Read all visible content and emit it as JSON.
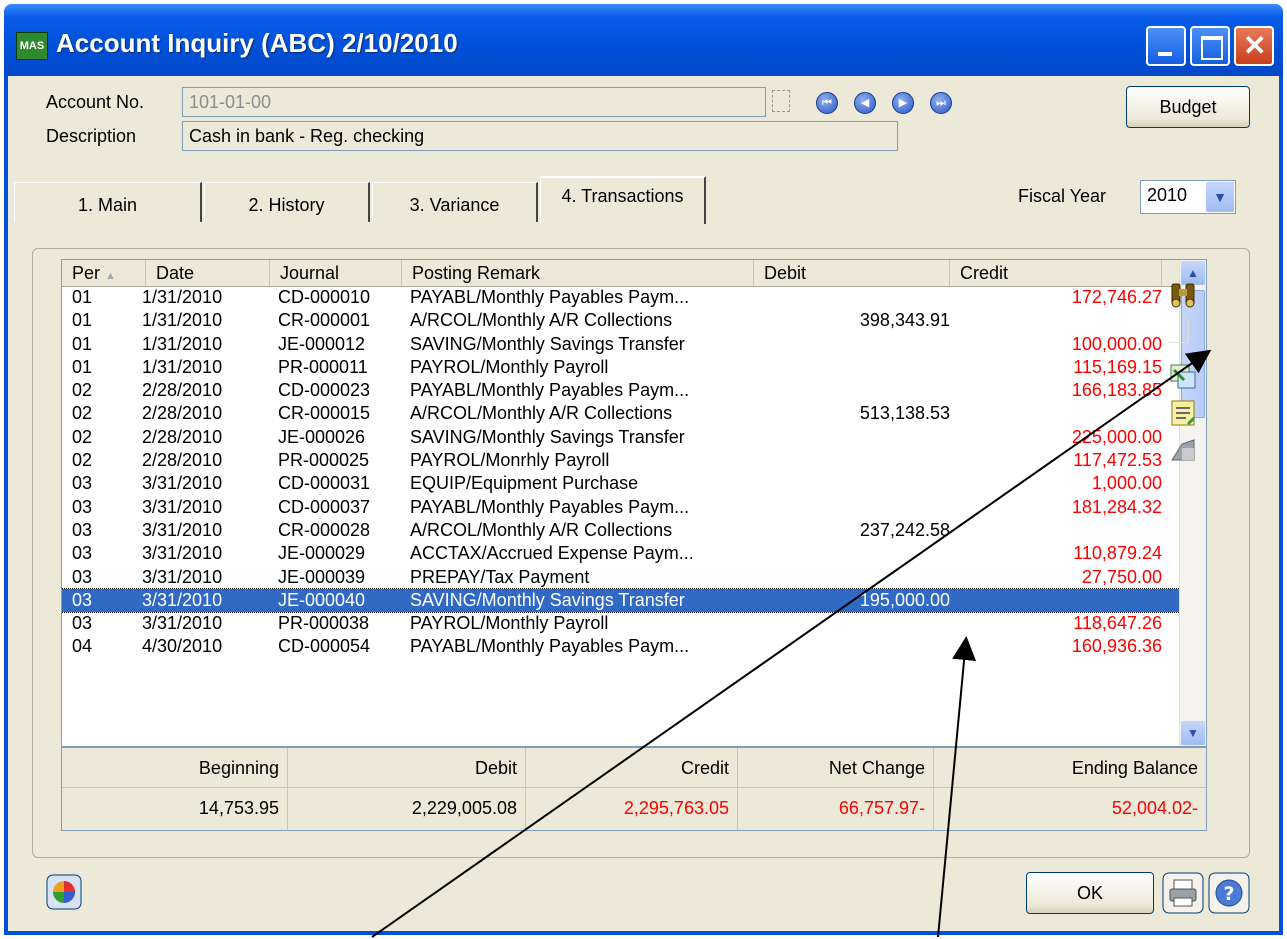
{
  "window": {
    "title": "Account Inquiry (ABC) 2/10/2010",
    "app_icon": "MAS"
  },
  "form": {
    "account_label": "Account No.",
    "account_value": "101-01-00",
    "description_label": "Description",
    "description_value": "Cash in bank - Reg. checking",
    "budget_button": "Budget",
    "fiscal_year_label": "Fiscal Year",
    "fiscal_year_value": "2010"
  },
  "tabs": [
    {
      "label": "1. Main"
    },
    {
      "label": "2. History"
    },
    {
      "label": "3. Variance"
    },
    {
      "label": "4. Transactions"
    }
  ],
  "grid": {
    "columns": [
      "Per",
      "Date",
      "Journal",
      "Posting Remark",
      "Debit",
      "Credit"
    ],
    "rows": [
      {
        "per": "01",
        "date": "1/31/2010",
        "journal": "CD-000010",
        "remark": "PAYABL/Monthly Payables Paym...",
        "debit": "",
        "credit": "172,746.27"
      },
      {
        "per": "01",
        "date": "1/31/2010",
        "journal": "CR-000001",
        "remark": "A/RCOL/Monthly A/R Collections",
        "debit": "398,343.91",
        "credit": ""
      },
      {
        "per": "01",
        "date": "1/31/2010",
        "journal": "JE-000012",
        "remark": "SAVING/Monthly Savings Transfer",
        "debit": "",
        "credit": "100,000.00"
      },
      {
        "per": "01",
        "date": "1/31/2010",
        "journal": "PR-000011",
        "remark": "PAYROL/Monthly Payroll",
        "debit": "",
        "credit": "115,169.15"
      },
      {
        "per": "02",
        "date": "2/28/2010",
        "journal": "CD-000023",
        "remark": "PAYABL/Monthly Payables Paym...",
        "debit": "",
        "credit": "166,183.85"
      },
      {
        "per": "02",
        "date": "2/28/2010",
        "journal": "CR-000015",
        "remark": "A/RCOL/Monthly A/R Collections",
        "debit": "513,138.53",
        "credit": ""
      },
      {
        "per": "02",
        "date": "2/28/2010",
        "journal": "JE-000026",
        "remark": "SAVING/Monthly Savings Transfer",
        "debit": "",
        "credit": "225,000.00"
      },
      {
        "per": "02",
        "date": "2/28/2010",
        "journal": "PR-000025",
        "remark": "PAYROL/Monrhly Payroll",
        "debit": "",
        "credit": "117,472.53"
      },
      {
        "per": "03",
        "date": "3/31/2010",
        "journal": "CD-000031",
        "remark": "EQUIP/Equipment Purchase",
        "debit": "",
        "credit": "1,000.00"
      },
      {
        "per": "03",
        "date": "3/31/2010",
        "journal": "CD-000037",
        "remark": "PAYABL/Monthly Payables Paym...",
        "debit": "",
        "credit": "181,284.32"
      },
      {
        "per": "03",
        "date": "3/31/2010",
        "journal": "CR-000028",
        "remark": "A/RCOL/Monthly A/R Collections",
        "debit": "237,242.58",
        "credit": ""
      },
      {
        "per": "03",
        "date": "3/31/2010",
        "journal": "JE-000029",
        "remark": "ACCTAX/Accrued Expense Paym...",
        "debit": "",
        "credit": "110,879.24"
      },
      {
        "per": "03",
        "date": "3/31/2010",
        "journal": "JE-000039",
        "remark": "PREPAY/Tax Payment",
        "debit": "",
        "credit": "27,750.00"
      },
      {
        "per": "03",
        "date": "3/31/2010",
        "journal": "JE-000040",
        "remark": "SAVING/Monthly Savings Transfer",
        "debit": "195,000.00",
        "credit": "",
        "selected": true
      },
      {
        "per": "03",
        "date": "3/31/2010",
        "journal": "PR-000038",
        "remark": "PAYROL/Monthly Payroll",
        "debit": "",
        "credit": "118,647.26"
      },
      {
        "per": "04",
        "date": "4/30/2010",
        "journal": "CD-000054",
        "remark": "PAYABL/Monthly Payables Paym...",
        "debit": "",
        "credit": "160,936.36"
      }
    ]
  },
  "totals": {
    "labels": [
      "Beginning",
      "Debit",
      "Credit",
      "Net Change",
      "Ending Balance"
    ],
    "values": [
      "14,753.95",
      "2,229,005.08",
      "2,295,763.05",
      "66,757.97-",
      "52,004.02-"
    ]
  },
  "side_icons": [
    "binoculars-find-icon",
    "drill-down-icon",
    "memo-icon",
    "print-preview-icon"
  ],
  "buttons": {
    "ok": "OK"
  },
  "colors": {
    "title_bar": "#0050d8",
    "window_bg": "#ece9d8",
    "selection": "#316ac5",
    "credit_text": "#ff0000"
  }
}
